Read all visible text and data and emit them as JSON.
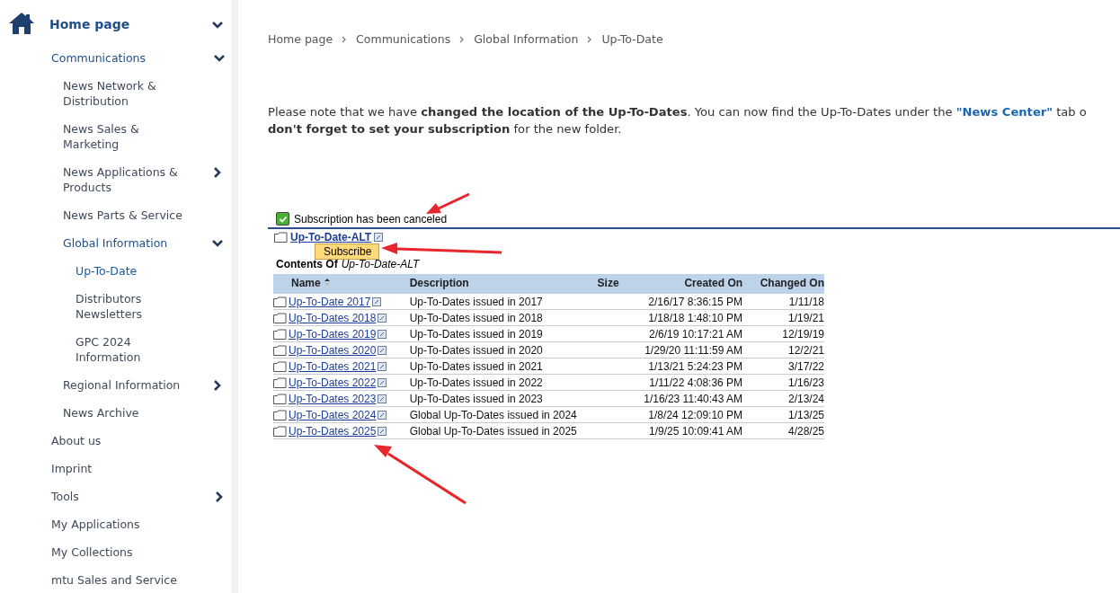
{
  "sidebar": {
    "items": [
      {
        "label": "Home page",
        "submenu": true,
        "expanded": true,
        "selected": false,
        "children": [
          {
            "label": "Communications",
            "submenu": true,
            "expanded": true,
            "selected": false,
            "children": [
              {
                "label": "News Network & Distribution",
                "submenu": false,
                "expanded": false,
                "selected": false
              },
              {
                "label": "News Sales & Marketing",
                "submenu": false,
                "expanded": false,
                "selected": false
              },
              {
                "label": "News Applications & Products",
                "submenu": true,
                "expanded": false,
                "selected": false
              },
              {
                "label": "News Parts & Service",
                "submenu": false,
                "expanded": false,
                "selected": false
              },
              {
                "label": "Global Information",
                "submenu": true,
                "expanded": true,
                "selected": false,
                "children": [
                  {
                    "label": "Up-To-Date",
                    "submenu": false,
                    "expanded": false,
                    "selected": true
                  },
                  {
                    "label": "Distributors Newsletters",
                    "submenu": false,
                    "expanded": false,
                    "selected": false
                  },
                  {
                    "label": "GPC 2024 Information",
                    "submenu": false,
                    "expanded": false,
                    "selected": false
                  }
                ]
              },
              {
                "label": "Regional Information",
                "submenu": true,
                "expanded": false,
                "selected": false
              },
              {
                "label": "News Archive",
                "submenu": false,
                "expanded": false,
                "selected": false
              }
            ]
          },
          {
            "label": "About us",
            "submenu": false,
            "expanded": false,
            "selected": false
          },
          {
            "label": "Imprint",
            "submenu": false,
            "expanded": false,
            "selected": false
          },
          {
            "label": "Tools",
            "submenu": true,
            "expanded": false,
            "selected": false
          },
          {
            "label": "My Applications",
            "submenu": false,
            "expanded": false,
            "selected": false
          },
          {
            "label": "My Collections",
            "submenu": false,
            "expanded": false,
            "selected": false
          },
          {
            "label": "mtu Sales and Service",
            "submenu": false,
            "expanded": false,
            "selected": false
          }
        ]
      }
    ]
  },
  "breadcrumb": [
    "Home page",
    "Communications",
    "Global Information",
    "Up-To-Date"
  ],
  "notice": {
    "before": "Please note that we have **changed the location of the Up-To-Dates**. You can now find the Up-To-Dates under the ",
    "link": "\"News Center\"",
    "after": " tab o",
    "line2": "**don't forget to set your subscription** for the new folder."
  },
  "status": {
    "checked": true,
    "message": "Subscription has been canceled"
  },
  "folder": {
    "name": "Up-To-Date-ALT",
    "tooltip": "Subscribe",
    "contents_label": "Contents Of",
    "contents_name": "Up-To-Date-ALT"
  },
  "table": {
    "columns": [
      {
        "label": "Name",
        "sorted": true
      },
      {
        "label": "Description",
        "sorted": false
      },
      {
        "label": "Size",
        "sorted": false
      },
      {
        "label": "Created On",
        "sorted": false
      },
      {
        "label": "Changed On",
        "sorted": false
      }
    ],
    "rows": [
      {
        "name": "Up-To-Date 2017",
        "description": "Up-To-Dates issued in 2017",
        "created": "2/16/17 8:36:15 PM",
        "changed": "1/11/18"
      },
      {
        "name": "Up-To-Dates 2018",
        "description": "Up-To-Dates issued in 2018",
        "created": "1/18/18 1:48:10 PM",
        "changed": "1/19/21"
      },
      {
        "name": "Up-To-Dates 2019",
        "description": "Up-To-Dates issued in 2019",
        "created": "2/6/19 10:17:21 AM",
        "changed": "12/19/19"
      },
      {
        "name": "Up-To-Dates 2020",
        "description": "Up-To-Dates issued in 2020",
        "created": "1/29/20 11:11:59 AM",
        "changed": "12/2/21"
      },
      {
        "name": "Up-To-Dates 2021",
        "description": "Up-To-Dates issued in 2021",
        "created": "1/13/21 5:24:23 PM",
        "changed": "3/17/22"
      },
      {
        "name": "Up-To-Dates 2022",
        "description": "Up-To-Dates issued in 2022",
        "created": "1/11/22 4:08:36 PM",
        "changed": "1/16/23"
      },
      {
        "name": "Up-To-Dates 2023",
        "description": "Up-To-Dates issued in 2023",
        "created": "1/16/23 11:40:43 AM",
        "changed": "2/13/24"
      },
      {
        "name": "Up-To-Dates 2024",
        "description": "Global Up-To-Dates issued in 2024",
        "created": "1/8/24 12:09:10 PM",
        "changed": "1/13/25"
      },
      {
        "name": "Up-To-Dates 2025",
        "description": "Global Up-To-Dates issued in 2025",
        "created": "1/9/25 10:09:41 AM",
        "changed": "4/28/25"
      }
    ]
  },
  "annotations": [
    {
      "kind": "arrow"
    },
    {
      "kind": "arrow"
    },
    {
      "kind": "arrow"
    }
  ]
}
